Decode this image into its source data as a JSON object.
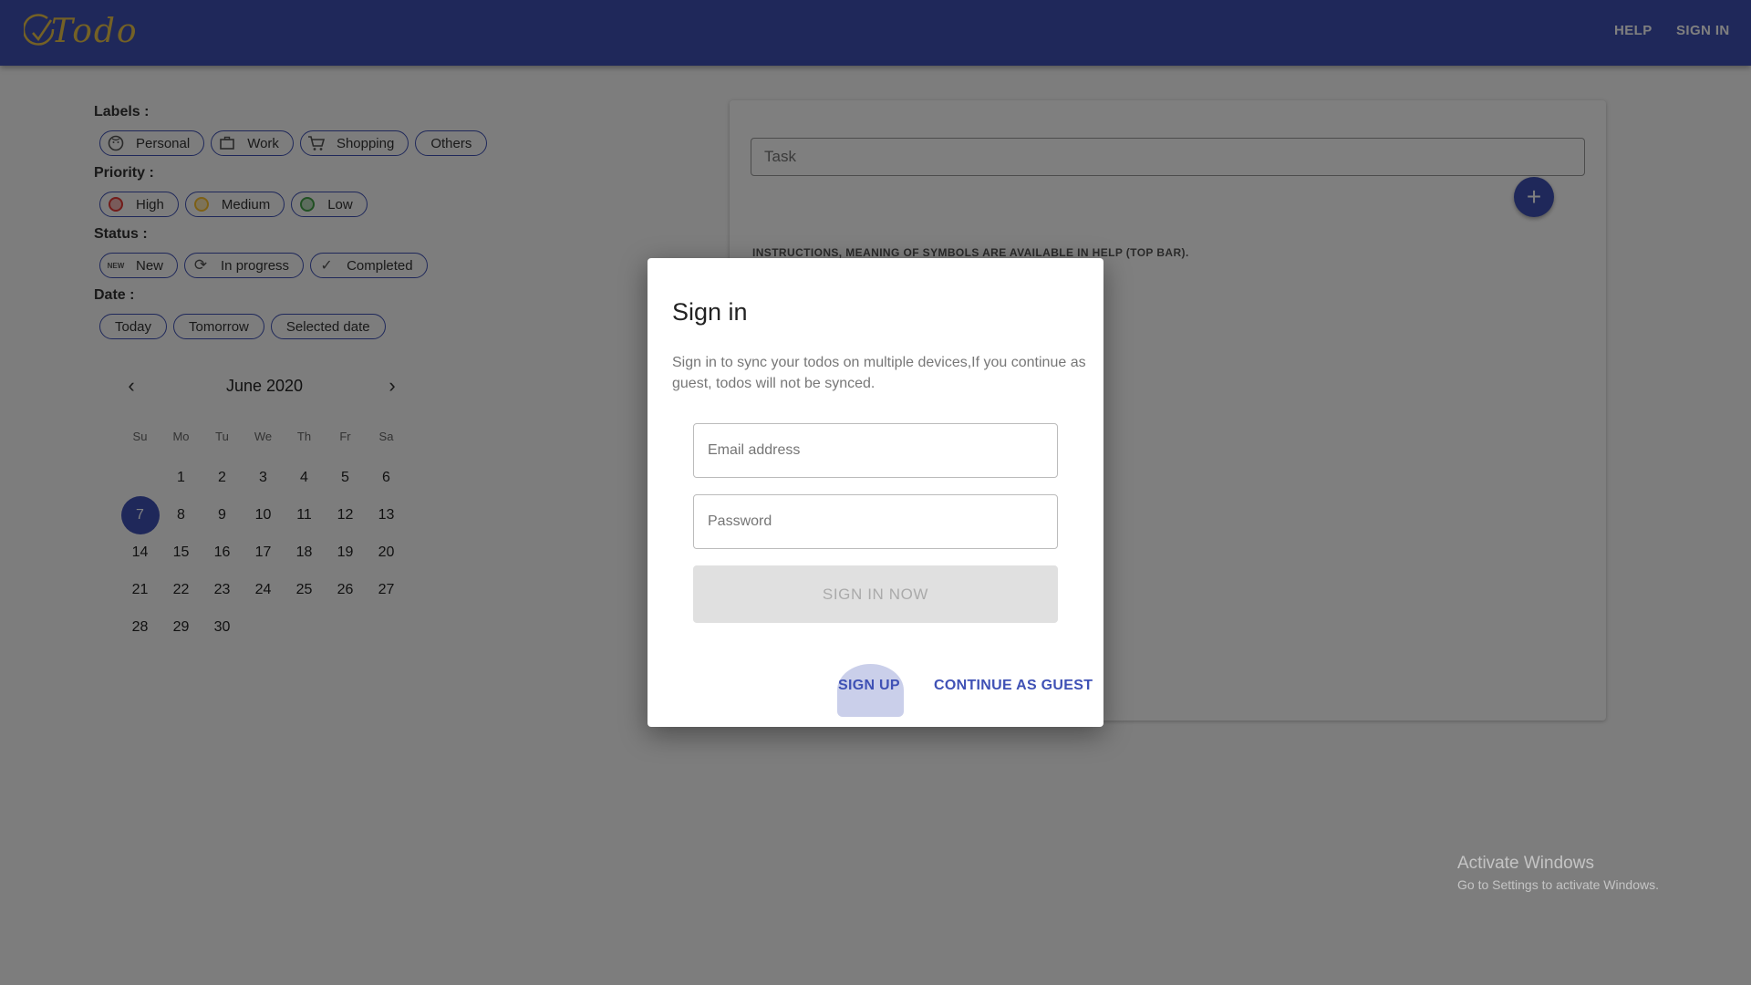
{
  "header": {
    "logo_text": "Todo",
    "nav": {
      "help": "HELP",
      "sign_in": "SIGN IN"
    },
    "colors": {
      "bar": "#3f51b5",
      "logo": "#e8c24a"
    }
  },
  "filters": {
    "labels_title": "Labels :",
    "labels": [
      {
        "label": "Personal",
        "icon": "face-icon"
      },
      {
        "label": "Work",
        "icon": "briefcase-icon"
      },
      {
        "label": "Shopping",
        "icon": "cart-icon"
      },
      {
        "label": "Others",
        "icon": ""
      }
    ],
    "priority_title": "Priority :",
    "priority": [
      {
        "label": "High",
        "color": "#e53935"
      },
      {
        "label": "Medium",
        "color": "#fbc02d"
      },
      {
        "label": "Low",
        "color": "#43a047"
      }
    ],
    "status_title": "Status :",
    "status": [
      {
        "label": "New",
        "icon": "new-icon",
        "glyph": "NEW"
      },
      {
        "label": "In progress",
        "icon": "refresh-icon",
        "glyph": "⟳"
      },
      {
        "label": "Completed",
        "icon": "check-icon",
        "glyph": "✓"
      }
    ],
    "date_title": "Date :",
    "dates": [
      "Today",
      "Tomorrow",
      "Selected date"
    ]
  },
  "calendar": {
    "month": "June 2020",
    "prev_glyph": "‹",
    "next_glyph": "›",
    "weekdays": [
      "Su",
      "Mo",
      "Tu",
      "We",
      "Th",
      "Fr",
      "Sa"
    ],
    "leading_blanks": 1,
    "days": 30,
    "selected": 7
  },
  "task_card": {
    "input_placeholder": "Task",
    "add_glyph": "+",
    "instructions": "INSTRUCTIONS, MEANING OF SYMBOLS ARE AVAILABLE IN HELP (TOP BAR)."
  },
  "dialog": {
    "title": "Sign in",
    "text": "Sign in to sync your todos on multiple devices,If you continue as guest, todos will not be synced.",
    "email_placeholder": "Email address",
    "password_placeholder": "Password",
    "sign_in_now": "SIGN IN NOW",
    "sign_up": "SIGN UP",
    "continue_guest": "CONTINUE AS GUEST"
  },
  "watermark": {
    "line1": "Activate Windows",
    "line2": "Go to Settings to activate Windows."
  }
}
